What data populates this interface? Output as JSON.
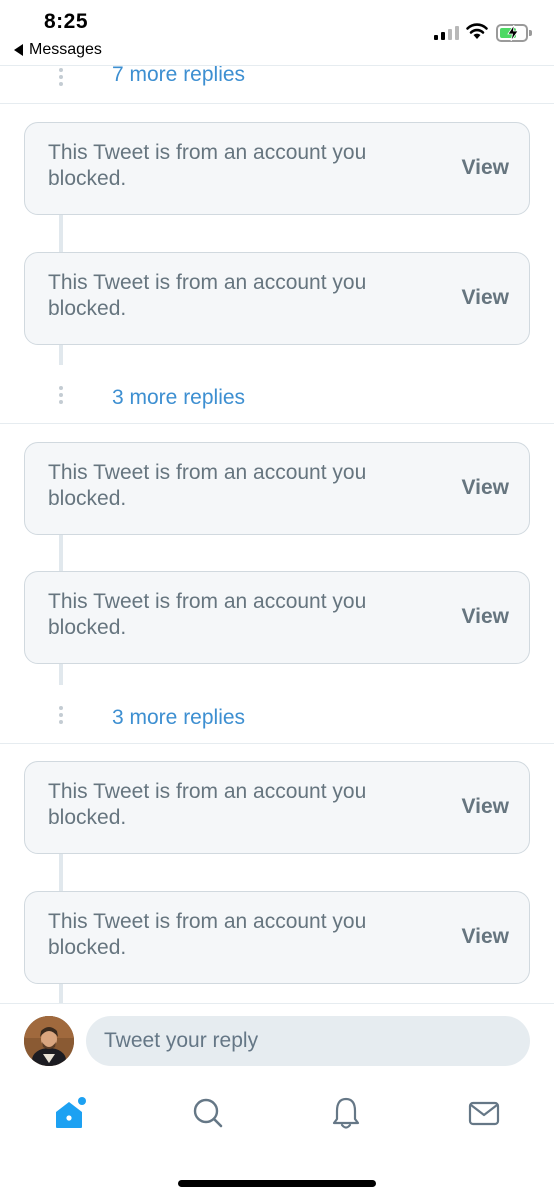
{
  "status_bar": {
    "time": "8:25",
    "back_label": "Messages"
  },
  "feed": {
    "blocked_message": "This Tweet is from an account you blocked.",
    "view_label": "View",
    "more_replies": [
      "7 more replies",
      "3 more replies",
      "3 more replies"
    ]
  },
  "reply_bar": {
    "placeholder": "Tweet your reply"
  },
  "tab_bar": {
    "tabs": [
      "home-icon",
      "search-icon",
      "notifications-icon",
      "messages-icon"
    ],
    "active_tab": "home-icon",
    "accent_color": "#1da1f2",
    "icon_color": "#657786"
  },
  "colors": {
    "link": "#3d8fd1",
    "card_background": "#f5f7f9",
    "muted_text": "#66757f"
  }
}
